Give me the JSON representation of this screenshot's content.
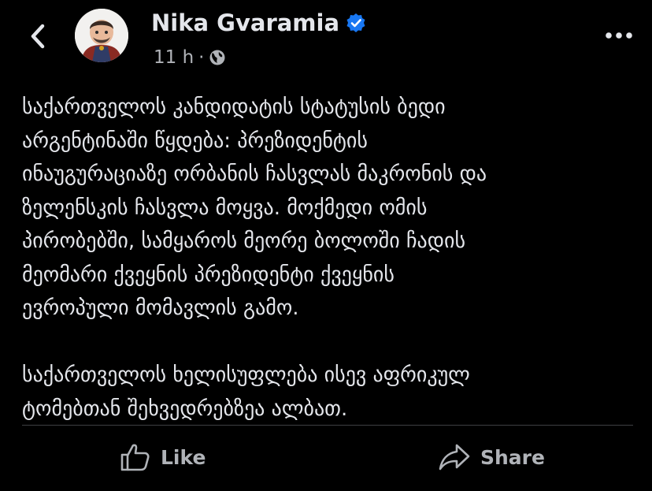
{
  "header": {
    "author_name": "Nika Gvaramia",
    "timestamp": "11 h",
    "separator": "·",
    "back_icon": "chevron-left-icon",
    "more_icon": "more-horizontal-icon",
    "verified_icon": "verified-badge-icon",
    "audience_icon": "globe-icon"
  },
  "post": {
    "lines_p1": [
      "საქართველოს კანდიდატის სტატუსის ბედი",
      "არგენტინაში წყდება: პრეზიდენტის",
      "ინაუგურაციაზე ორბანის ჩასვლას მაკრონის და",
      "ზელენსკის ჩასვლა მოყვა. მოქმედი ომის",
      "პირობებში, სამყაროს მეორე ბოლოში ჩადის",
      "მეომარი ქვეყნის პრეზიდენტი ქვეყნის",
      "ევროპული მომავლის გამო."
    ],
    "lines_p2": [
      "საქართველოს ხელისუფლება ისევ აფრიკულ",
      "ტომებთან შეხვედრებზეა ალბათ."
    ]
  },
  "actions": {
    "like_label": "Like",
    "share_label": "Share",
    "like_icon": "thumbs-up-icon",
    "share_icon": "share-arrow-icon"
  },
  "colors": {
    "background": "#000000",
    "text_primary": "#e4e6eb",
    "text_secondary": "#b0b3b8",
    "verified_blue": "#1877f2",
    "divider": "#3e4042"
  }
}
